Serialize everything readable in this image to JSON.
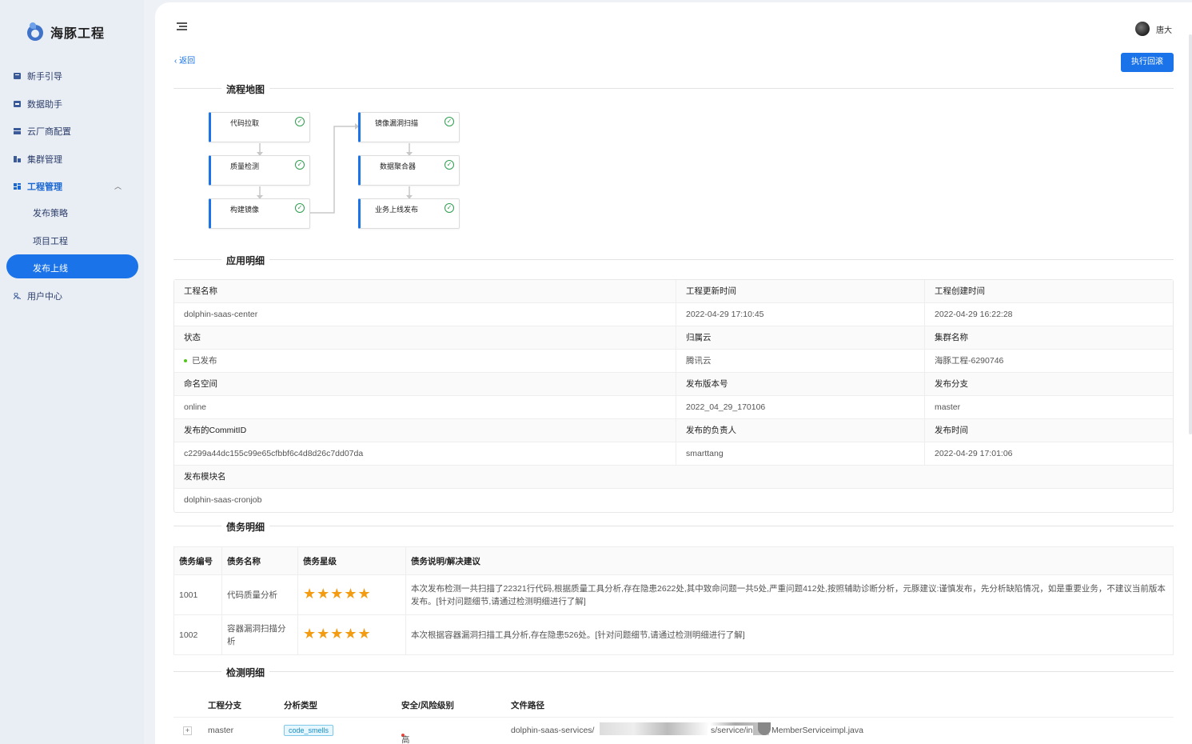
{
  "app": {
    "name": "海豚工程"
  },
  "sidebar": {
    "items": [
      {
        "label": "新手引导",
        "icon": "guide-icon"
      },
      {
        "label": "数据助手",
        "icon": "data-icon"
      },
      {
        "label": "云厂商配置",
        "icon": "cloud-icon"
      },
      {
        "label": "集群管理",
        "icon": "cluster-icon"
      },
      {
        "label": "工程管理",
        "icon": "project-icon"
      },
      {
        "label": "用户中心",
        "icon": "user-icon"
      }
    ],
    "sub_items": [
      "发布策略",
      "项目工程",
      "发布上线"
    ],
    "active_sub": "发布上线"
  },
  "header": {
    "user_name": "唐大"
  },
  "toolbar": {
    "back_label": "返回",
    "rollback_label": "执行回滚"
  },
  "sections": {
    "flow": "流程地图",
    "app_detail": "应用明细",
    "debt": "债务明细",
    "detection": "检测明细"
  },
  "flow": {
    "left": [
      "代码拉取",
      "质量检测",
      "构建镜像"
    ],
    "right": [
      "镜像漏洞扫描",
      "数据聚合器",
      "业务上线发布"
    ]
  },
  "detail": {
    "rows": [
      {
        "labels": [
          "工程名称",
          "工程更新时间",
          "工程创建时间"
        ],
        "values": [
          "dolphin-saas-center",
          "2022-04-29 17:10:45",
          "2022-04-29 16:22:28"
        ]
      },
      {
        "labels": [
          "状态",
          "归属云",
          "集群名称"
        ],
        "values": [
          "已发布",
          "腾讯云",
          "海豚工程-6290746"
        ]
      },
      {
        "labels": [
          "命名空间",
          "发布版本号",
          "发布分支"
        ],
        "values": [
          "online",
          "2022_04_29_170106",
          "master"
        ]
      },
      {
        "labels": [
          "发布的CommitID",
          "发布的负责人",
          "发布时间"
        ],
        "values": [
          "c2299a44dc155c99e65cfbbf6c4d8d26c7dd07da",
          "smarttang",
          "2022-04-29 17:01:06"
        ]
      }
    ],
    "module_label": "发布模块名",
    "module_value": "dolphin-saas-cronjob"
  },
  "debt": {
    "headers": [
      "债务编号",
      "债务名称",
      "债务星级",
      "债务说明/解决建议"
    ],
    "rows": [
      {
        "id": "1001",
        "name": "代码质量分析",
        "stars": 5,
        "desc": "本次发布检测一共扫描了22321行代码,根据质量工具分析,存在隐患2622处,其中致命问题一共5处,严重问题412处,按照辅助诊断分析，元豚建议:谨慎发布，先分析缺陷情况，如是重要业务，不建议当前版本发布。[针对问题细节,请通过检测明细进行了解]"
      },
      {
        "id": "1002",
        "name": "容器漏洞扫描分析",
        "stars": 5,
        "desc": "本次根据容器漏洞扫描工具分析,存在隐患526处。[针对问题细节,请通过检测明细进行了解]"
      }
    ]
  },
  "detection": {
    "headers": [
      "工程分支",
      "分析类型",
      "安全/风险级别",
      "文件路径"
    ],
    "rows": [
      {
        "branch": "master",
        "type": "code_smells",
        "level": "高风险",
        "path_start": "dolphin-saas-services/",
        "path_mid": "s/service/in",
        "path_end": "MemberServiceimpl.java"
      }
    ]
  },
  "colors": {
    "accent": "#1a73e8",
    "success": "#2e9e4f",
    "star": "#f39c12",
    "danger": "#e8453c"
  }
}
